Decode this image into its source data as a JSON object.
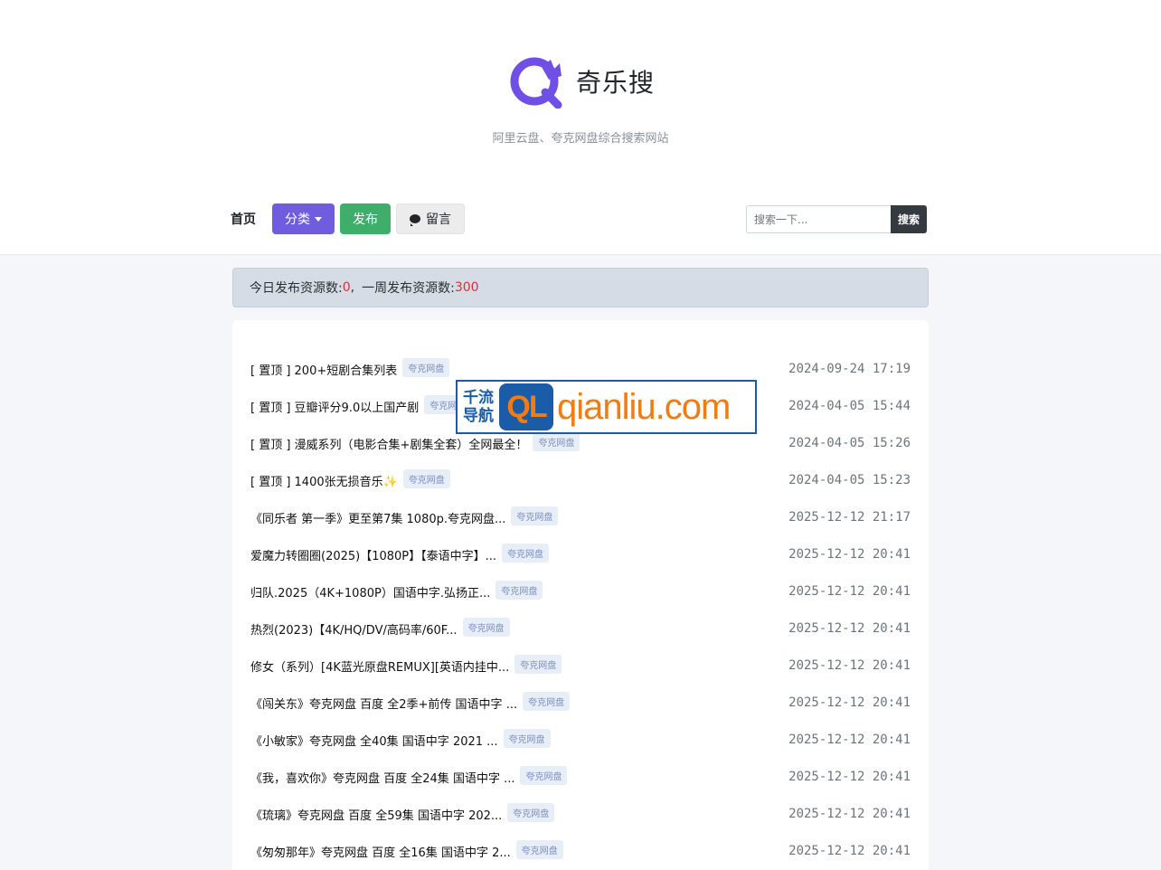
{
  "header": {
    "site_name": "奇乐搜",
    "tagline": "阿里云盘、夸克网盘综合搜索网站",
    "logo_color": "#6f4fe6"
  },
  "nav": {
    "home": "首页",
    "category": "分类",
    "publish": "发布",
    "message": "留言",
    "message_icon": "speech-bubble-icon"
  },
  "search": {
    "placeholder": "搜索一下...",
    "button": "搜索"
  },
  "stats": {
    "today_label": "今日发布资源数:",
    "today_value": "0",
    "separator": ",",
    "week_label": "一周发布资源数:",
    "week_value": "300"
  },
  "ad": {
    "cn_top": "千流",
    "cn_bottom": "导航",
    "ql": "QL",
    "url": "qianliu.com"
  },
  "list": [
    {
      "title": "[ 置顶 ] 200+短剧合集列表",
      "tag": "夸克网盘",
      "time": "2024-09-24 17:19"
    },
    {
      "title": "[ 置顶 ] 豆瓣评分9.0以上国产剧",
      "tag": "夸克网盘",
      "time": "2024-04-05 15:44"
    },
    {
      "title": "[ 置顶 ] 漫威系列（电影合集+剧集全套）全网最全！",
      "tag": "夸克网盘",
      "time": "2024-04-05 15:26"
    },
    {
      "title": "[ 置顶 ] 1400张无损音乐✨",
      "tag": "夸克网盘",
      "time": "2024-04-05 15:23"
    },
    {
      "title": "《同乐者 第一季》更至第7集 1080p.夸克网盘...",
      "tag": "夸克网盘",
      "time": "2025-12-12 21:17"
    },
    {
      "title": "爱魔力转圈圈(2025)【1080P】【泰语中字】...",
      "tag": "夸克网盘",
      "time": "2025-12-12 20:41"
    },
    {
      "title": "归队.2025（4K+1080P）国语中字.弘扬正...",
      "tag": "夸克网盘",
      "time": "2025-12-12 20:41"
    },
    {
      "title": "热烈(2023)【4K/HQ/DV/高码率/60F...",
      "tag": "夸克网盘",
      "time": "2025-12-12 20:41"
    },
    {
      "title": "修女（系列）[4K蓝光原盘REMUX][英语内挂中...",
      "tag": "夸克网盘",
      "time": "2025-12-12 20:41"
    },
    {
      "title": "《闯关东》夸克网盘 百度 全2季+前传 国语中字 ...",
      "tag": "夸克网盘",
      "time": "2025-12-12 20:41"
    },
    {
      "title": "《小敏家》夸克网盘 全40集 国语中字 2021 ...",
      "tag": "夸克网盘",
      "time": "2025-12-12 20:41"
    },
    {
      "title": "《我，喜欢你》夸克网盘 百度 全24集 国语中字 ...",
      "tag": "夸克网盘",
      "time": "2025-12-12 20:41"
    },
    {
      "title": "《琉璃》夸克网盘 百度 全59集 国语中字 202...",
      "tag": "夸克网盘",
      "time": "2025-12-12 20:41"
    },
    {
      "title": "《匆匆那年》夸克网盘 百度 全16集 国语中字 2...",
      "tag": "夸克网盘",
      "time": "2025-12-12 20:41"
    }
  ]
}
